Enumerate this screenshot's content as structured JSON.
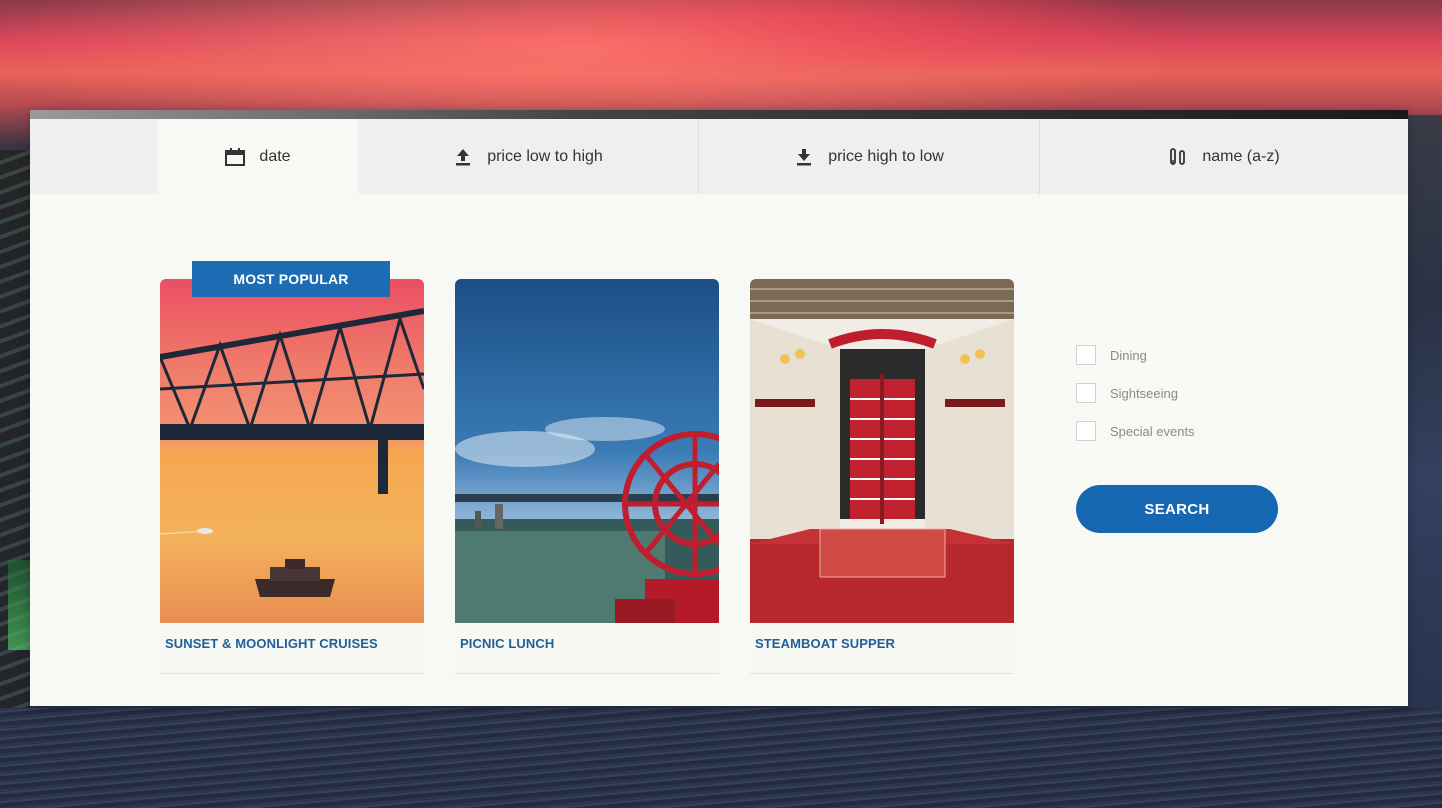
{
  "sort_tabs": [
    {
      "label": "date",
      "icon": "calendar-icon",
      "active": true
    },
    {
      "label": "price low to high",
      "icon": "upload-icon",
      "active": false
    },
    {
      "label": "price high to low",
      "icon": "download-icon",
      "active": false
    },
    {
      "label": "name (a-z)",
      "icon": "sort-alpha-icon",
      "active": false
    }
  ],
  "badge": {
    "label": "MOST POPULAR"
  },
  "cards": [
    {
      "title": "SUNSET & MOONLIGHT CRUISES"
    },
    {
      "title": "PICNIC LUNCH"
    },
    {
      "title": "STEAMBOAT SUPPER"
    }
  ],
  "filters": [
    {
      "label": "Dining",
      "checked": false
    },
    {
      "label": "Sightseeing",
      "checked": false
    },
    {
      "label": "Special events",
      "checked": false
    }
  ],
  "search": {
    "label": "SEARCH"
  },
  "colors": {
    "accent": "#1e6cb3",
    "card_title": "#1f5f97",
    "panel": "#f8f8f5",
    "tab_bar": "#efefef"
  }
}
